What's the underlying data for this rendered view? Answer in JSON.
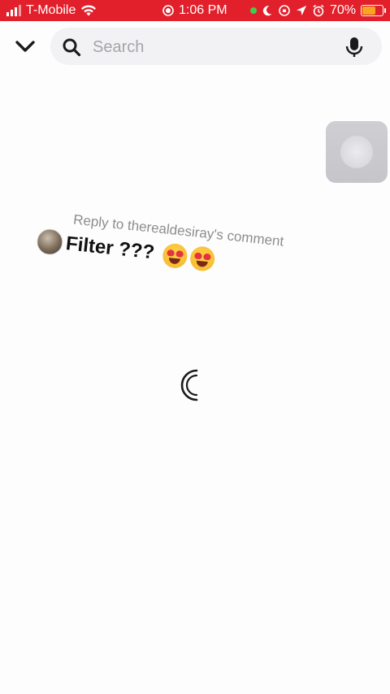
{
  "status_bar": {
    "carrier": "T-Mobile",
    "time": "1:06 PM",
    "battery_percent": "70%",
    "battery_level": 0.7,
    "colors": {
      "background": "#e2202c",
      "battery_fill": "#f5a623",
      "camera_dot": "#3ccf4e"
    },
    "icons": [
      "signal-icon",
      "wifi-icon",
      "screen-record-icon",
      "camera-in-use-dot",
      "moon-icon",
      "orientation-lock-icon",
      "location-icon",
      "alarm-icon",
      "battery-icon"
    ]
  },
  "header": {
    "back_icon": "chevron-down-icon",
    "search": {
      "placeholder": "Search",
      "value": ""
    },
    "search_icon": "search-icon",
    "mic_icon": "mic-icon"
  },
  "lens_thumbnail": {
    "icon": "lens-thumbnail"
  },
  "reply_sticker": {
    "caption": "Reply to therealdesiray's comment",
    "comment": "Filter ???",
    "emojis": [
      "heart-eyes-emoji",
      "heart-eyes-emoji"
    ]
  },
  "loading": {
    "icon": "loading-spinner-icon"
  }
}
